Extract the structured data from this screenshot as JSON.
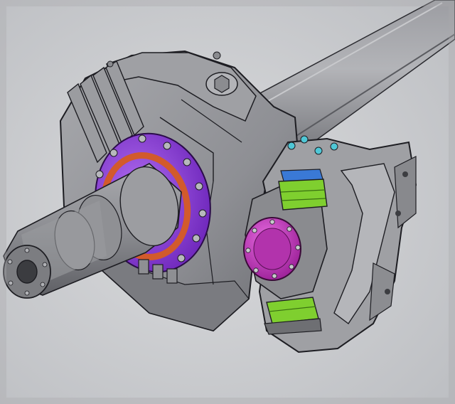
{
  "scene": {
    "subject": "cad-render-axle-assembly",
    "colors": {
      "background": "#d3d4d6",
      "metal_light": "#a7a8ac",
      "metal_mid": "#8a8b90",
      "metal_dark": "#55565b",
      "edge": "#1d1d22",
      "purple_flange": "#8a3fd6",
      "orange_seal": "#d25a2c",
      "magenta_cap": "#c83cc2",
      "green_bushing": "#7fcf2f",
      "blue_bushing": "#3a79d6",
      "cyan_bolt": "#4fc7d6"
    }
  }
}
